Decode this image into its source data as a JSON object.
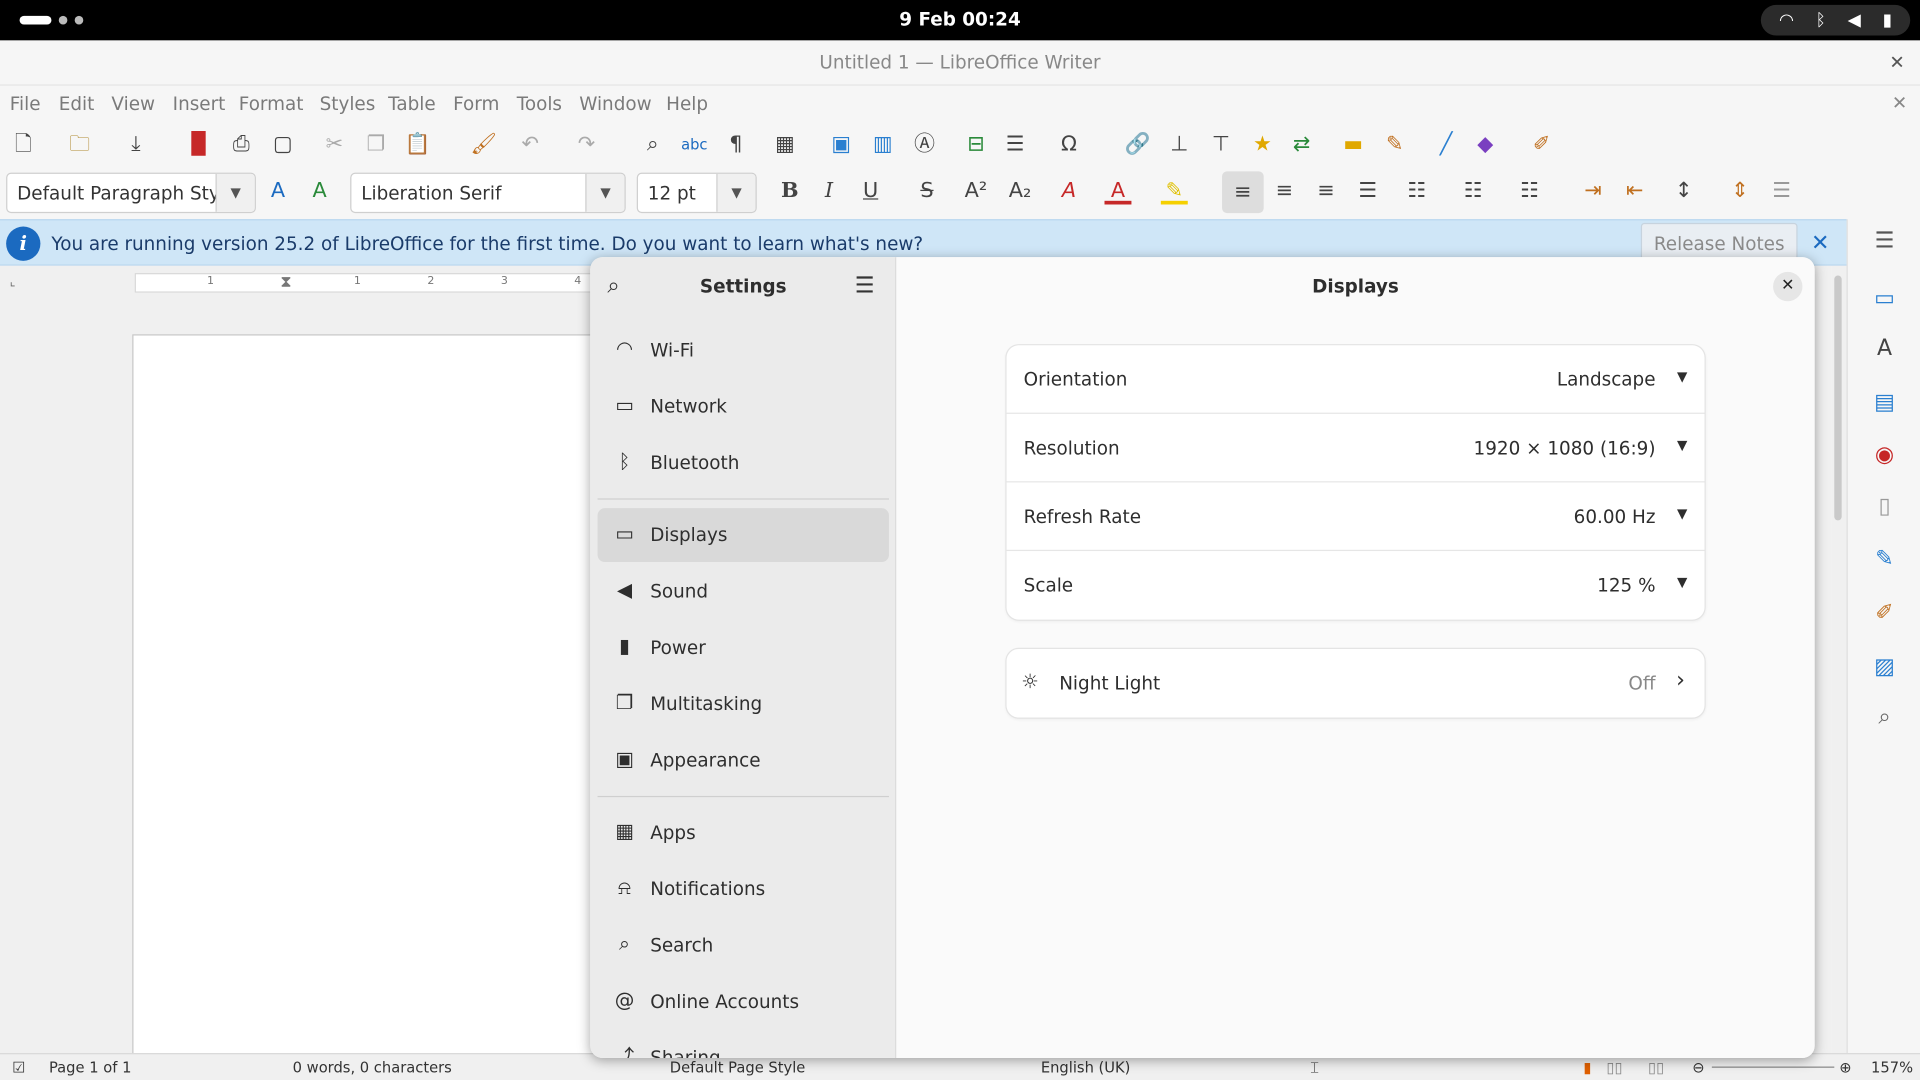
{
  "topbar": {
    "clock": "9 Feb  00:24"
  },
  "writer": {
    "title": "Untitled 1 — LibreOffice Writer",
    "menu": [
      "File",
      "Edit",
      "View",
      "Insert",
      "Format",
      "Styles",
      "Table",
      "Form",
      "Tools",
      "Window",
      "Help"
    ],
    "paragraph_style": "Default Paragraph Style",
    "font_name": "Liberation Serif",
    "font_size": "12 pt",
    "infobar": {
      "text": "You are running version 25.2 of LibreOffice for the first time. Do you want to learn what's new?",
      "button": "Release Notes"
    },
    "ruler_marks": [
      "1",
      "1",
      "2",
      "3",
      "4"
    ],
    "status": {
      "page": "Page 1 of 1",
      "words": "0 words, 0 characters",
      "page_style": "Default Page Style",
      "language": "English (UK)",
      "zoom": "157%"
    }
  },
  "settings": {
    "sidebar_title": "Settings",
    "nav_group1": [
      "Wi-Fi",
      "Network",
      "Bluetooth"
    ],
    "nav_group2": [
      "Displays",
      "Sound",
      "Power",
      "Multitasking",
      "Appearance"
    ],
    "nav_group3": [
      "Apps",
      "Notifications",
      "Search",
      "Online Accounts",
      "Sharing"
    ],
    "selected": "Displays",
    "page_title": "Displays",
    "rows": [
      {
        "label": "Orientation",
        "value": "Landscape"
      },
      {
        "label": "Resolution",
        "value": "1920 × 1080 (16:9)"
      },
      {
        "label": "Refresh Rate",
        "value": "60.00 Hz"
      },
      {
        "label": "Scale",
        "value": "125 %"
      }
    ],
    "night_light": {
      "label": "Night Light",
      "value": "Off"
    }
  }
}
